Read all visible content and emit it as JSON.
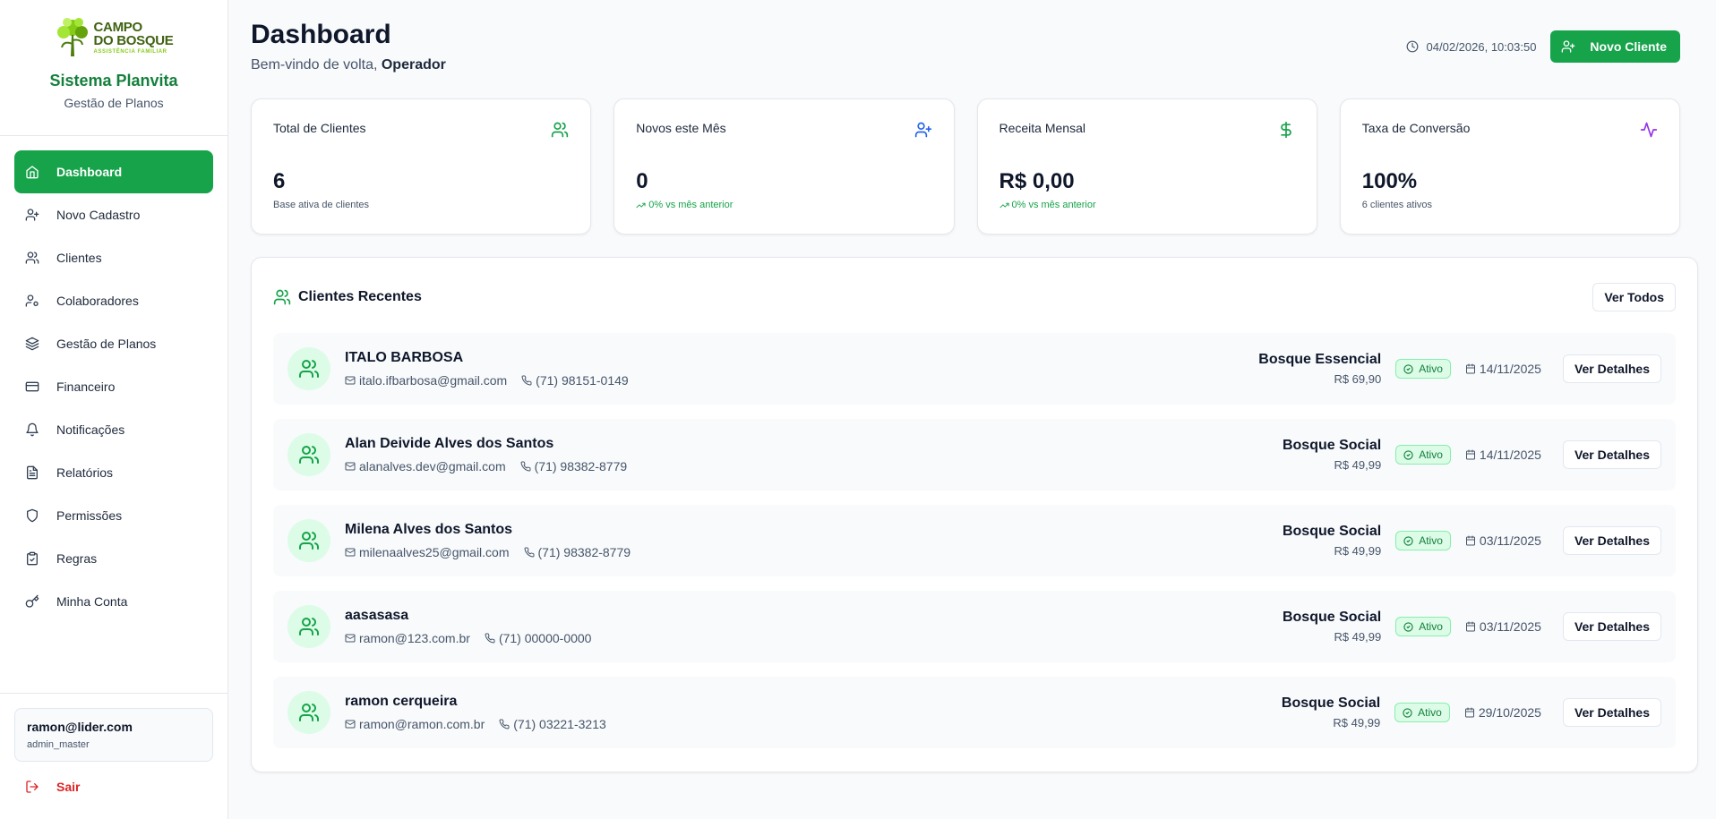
{
  "brand": {
    "logo_line1": "CAMPO",
    "logo_line2": "DO BOSQUE",
    "logo_sub": "ASSISTÊNCIA FAMILIAR",
    "title": "Sistema Planvita",
    "subtitle": "Gestão de Planos"
  },
  "sidebar": {
    "items": [
      {
        "label": "Dashboard",
        "icon": "home-icon"
      },
      {
        "label": "Novo Cadastro",
        "icon": "user-plus-icon"
      },
      {
        "label": "Clientes",
        "icon": "users-icon"
      },
      {
        "label": "Colaboradores",
        "icon": "user-cog-icon"
      },
      {
        "label": "Gestão de Planos",
        "icon": "layers-icon"
      },
      {
        "label": "Financeiro",
        "icon": "credit-card-icon"
      },
      {
        "label": "Notificações",
        "icon": "bell-icon"
      },
      {
        "label": "Relatórios",
        "icon": "file-text-icon"
      },
      {
        "label": "Permissões",
        "icon": "shield-icon"
      },
      {
        "label": "Regras",
        "icon": "clipboard-check-icon"
      },
      {
        "label": "Minha Conta",
        "icon": "key-icon"
      }
    ],
    "active": "Dashboard"
  },
  "user": {
    "email": "ramon@lider.com",
    "role": "admin_master",
    "logout_label": "Sair"
  },
  "header": {
    "title": "Dashboard",
    "welcome_prefix": "Bem-vindo de volta,",
    "welcome_name": "Operador",
    "datetime": "04/02/2026, 10:03:50",
    "new_client_label": "Novo Cliente"
  },
  "stats": [
    {
      "label": "Total de Clientes",
      "value": "6",
      "note": "Base ativa de clientes",
      "icon": "users-icon",
      "color": "#16a34a"
    },
    {
      "label": "Novos este Mês",
      "value": "0",
      "note": "0% vs mês anterior",
      "icon": "user-plus-icon",
      "color": "#2563eb"
    },
    {
      "label": "Receita Mensal",
      "value": "R$ 0,00",
      "note": "0% vs mês anterior",
      "icon": "dollar-icon",
      "color": "#16a34a"
    },
    {
      "label": "Taxa de Conversão",
      "value": "100%",
      "note": "6 clientes ativos",
      "icon": "activity-icon",
      "color": "#9333ea"
    }
  ],
  "recent": {
    "title": "Clientes Recentes",
    "view_all_label": "Ver Todos",
    "details_label": "Ver Detalhes",
    "status_label": "Ativo",
    "clients": [
      {
        "name": "ITALO BARBOSA",
        "email": "italo.ifbarbosa@gmail.com",
        "phone": "(71) 98151-0149",
        "plan": "Bosque Essencial",
        "price": "R$ 69,90",
        "date": "14/11/2025"
      },
      {
        "name": "Alan Deivide Alves dos Santos",
        "email": "alanalves.dev@gmail.com",
        "phone": "(71) 98382-8779",
        "plan": "Bosque Social",
        "price": "R$ 49,99",
        "date": "14/11/2025"
      },
      {
        "name": "Milena Alves dos Santos",
        "email": "milenaalves25@gmail.com",
        "phone": "(71) 98382-8779",
        "plan": "Bosque Social",
        "price": "R$ 49,99",
        "date": "03/11/2025"
      },
      {
        "name": "aasasasa",
        "email": "ramon@123.com.br",
        "phone": "(71) 00000-0000",
        "plan": "Bosque Social",
        "price": "R$ 49,99",
        "date": "03/11/2025"
      },
      {
        "name": "ramon cerqueira",
        "email": "ramon@ramon.com.br",
        "phone": "(71) 03221-3213",
        "plan": "Bosque Social",
        "price": "R$ 49,99",
        "date": "29/10/2025"
      }
    ]
  },
  "colors": {
    "primary": "#16a34a",
    "danger": "#dc2626",
    "blue": "#2563eb",
    "purple": "#9333ea"
  }
}
